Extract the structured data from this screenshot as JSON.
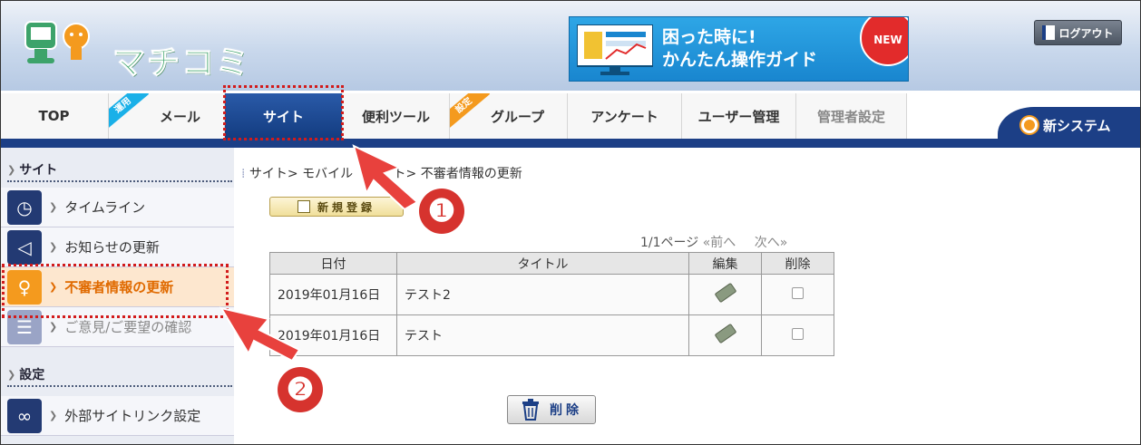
{
  "header": {
    "logo_text": "マチコミ",
    "banner_line1": "困った時に!",
    "banner_line2": "かんたん操作ガイド",
    "banner_badge": "NEW",
    "logout_label": "ログアウト"
  },
  "nav": {
    "tabs": [
      {
        "label": "TOP"
      },
      {
        "label": "メール",
        "ribbon": "運用"
      },
      {
        "label": "サイト"
      },
      {
        "label": "便利ツール"
      },
      {
        "label": "グループ",
        "ribbon": "設定"
      },
      {
        "label": "アンケート"
      },
      {
        "label": "ユーザー管理"
      },
      {
        "label": "管理者設定"
      }
    ],
    "new_system": "新システム"
  },
  "sidebar": {
    "section_site": "サイト",
    "items": [
      {
        "label": "タイムライン"
      },
      {
        "label": "お知らせの更新"
      },
      {
        "label": "不審者情報の更新"
      },
      {
        "label": "ご意見/ご要望の確認"
      }
    ],
    "section_settings": "設定",
    "settings_items": [
      {
        "label": "外部サイトリンク設定"
      }
    ]
  },
  "main": {
    "breadcrumb": "サイト> モバイル",
    "breadcrumb_tail": "ト> 不審者情報の更新",
    "new_button": "新規登録",
    "pager": "1/1ページ",
    "prev": "前へ",
    "next": "次へ",
    "columns": [
      "日付",
      "タイトル",
      "編集",
      "削除"
    ],
    "rows": [
      {
        "date": "2019年01月16日",
        "title": "テスト2"
      },
      {
        "date": "2019年01月16日",
        "title": "テスト"
      }
    ],
    "delete_button": "削除"
  },
  "annotations": {
    "step1": "❶",
    "step2": "❷"
  }
}
